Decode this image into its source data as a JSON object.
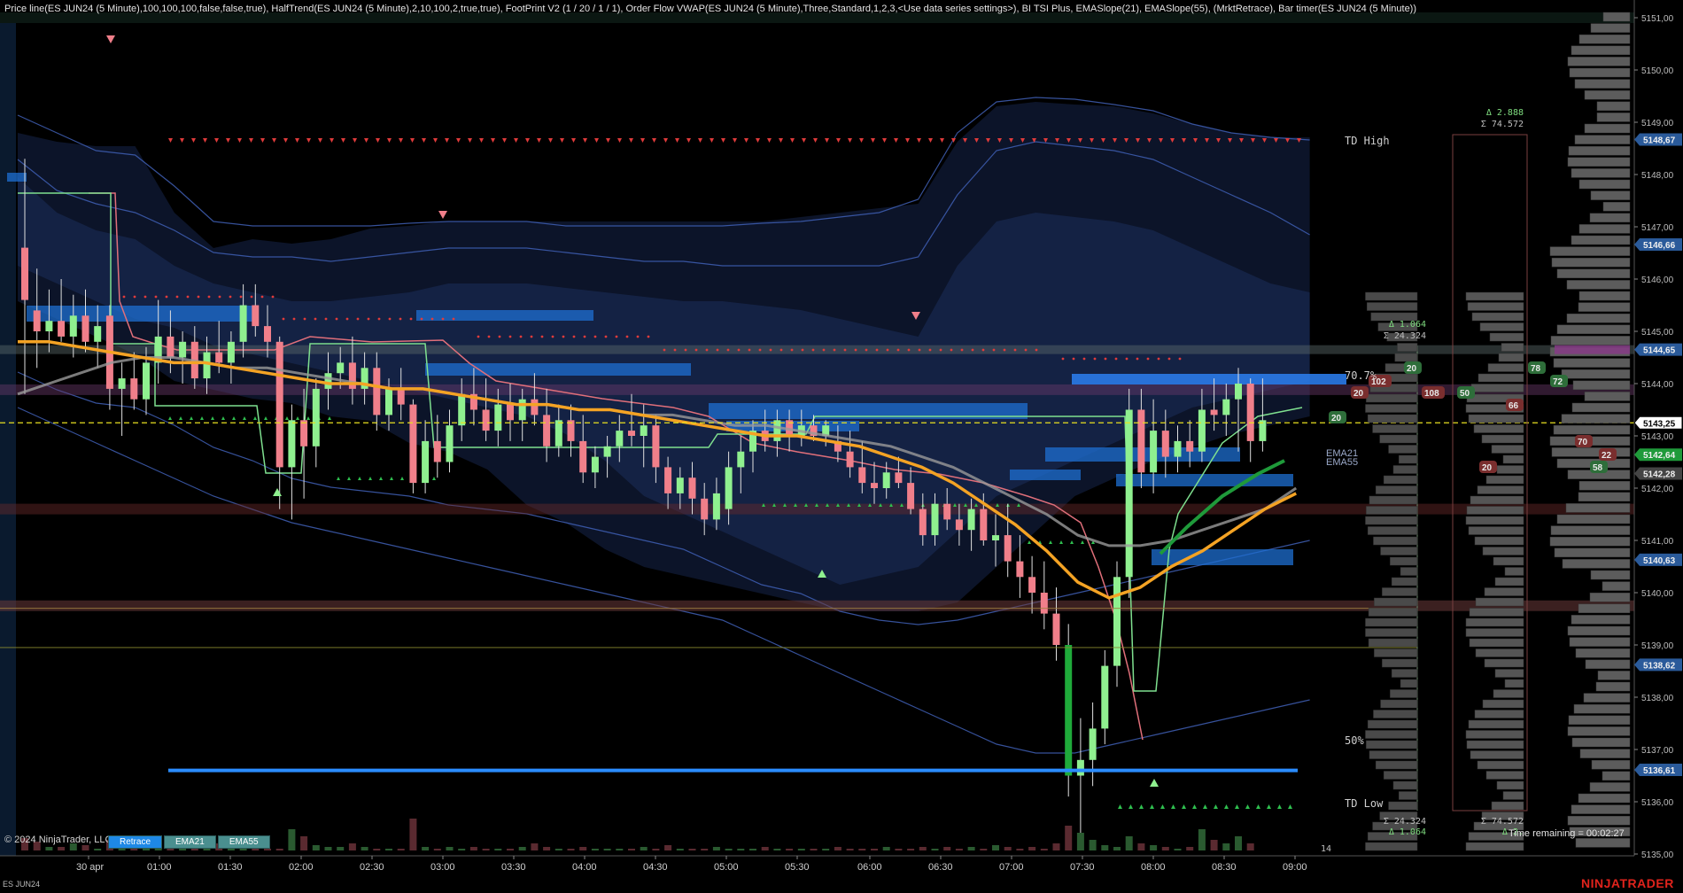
{
  "header": {
    "indicator_legend": "Price line(ES JUN24 (5 Minute),100,100,100,false,false,true), HalfTrend(ES JUN24 (5 Minute),2,10,100,2,true,true), FootPrint V2 (1 / 20 / 1 / 1), Order Flow VWAP(ES JUN24 (5 Minute),Three,Standard,1,2,3,<Use data series settings>), BI TSI Plus, EMASlope(21), EMASlope(55),  (MrktRetrace), Bar timer(ES JUN24 (5 Minute))"
  },
  "footer": {
    "copyright": "© 2024 NinjaTrader, LLC",
    "tabs": [
      "Retrace",
      "EMA21",
      "EMA55"
    ],
    "time_remaining": "Time remaining = 00:02:27",
    "instrument": "ES JUN24",
    "brand": "NINJATRADER"
  },
  "labels": {
    "td_high": "TD High",
    "td_low": "TD Low",
    "fib_70": "70.7%",
    "fib_50": "50%",
    "ema21": "EMA21",
    "ema55": "EMA55",
    "left_delta_top": "Δ 1.064",
    "left_sigma_top": "Σ 24.324",
    "left_sigma_bot": "Σ 24.324",
    "left_delta_bot": "Δ 1.064",
    "right_delta_top": "Δ 2.888",
    "right_sigma_top": "Σ 74.572",
    "right_sigma_bot": "Σ 74.572",
    "right_delta_bot": "Δ 2.",
    "bottom_number": "14"
  },
  "chart_data": {
    "type": "candlestick",
    "title": "",
    "instrument": "ES JUN24",
    "interval": "5 Minute",
    "date_label": "30 apr",
    "x_ticks": [
      "30 apr",
      "01:00",
      "01:30",
      "02:00",
      "02:30",
      "03:00",
      "03:30",
      "04:00",
      "04:30",
      "05:00",
      "05:30",
      "06:00",
      "06:30",
      "07:00",
      "07:30",
      "08:00",
      "08:30",
      "09:00"
    ],
    "y_ticks": [
      5151.0,
      5150.0,
      5149.0,
      5148.0,
      5147.0,
      5146.0,
      5145.0,
      5144.0,
      5143.0,
      5142.0,
      5141.0,
      5140.0,
      5139.0,
      5138.0,
      5137.0,
      5136.0,
      5135.0
    ],
    "ylim": [
      5134.6,
      5151.3
    ],
    "price_markers": [
      {
        "label": "5148.67",
        "value": 5148.67,
        "color": "#2a5a9a"
      },
      {
        "label": "5146.66",
        "value": 5146.66,
        "color": "#2a5a9a"
      },
      {
        "label": "5144.65",
        "value": 5144.65,
        "color": "#2a5a9a"
      },
      {
        "label": "5143.25",
        "value": 5143.25,
        "color": "#ffffff"
      },
      {
        "label": "5142.64",
        "value": 5142.64,
        "color": "#1f9a3a"
      },
      {
        "label": "5142.28",
        "value": 5142.28,
        "color": "#444444"
      },
      {
        "label": "5140.63",
        "value": 5140.63,
        "color": "#2a5a9a"
      },
      {
        "label": "5138.62",
        "value": 5138.62,
        "color": "#2a5a9a"
      },
      {
        "label": "5136.61",
        "value": 5136.61,
        "color": "#2a5a9a"
      }
    ],
    "footprint_boxes": [
      {
        "label": "20",
        "color": "#2e6e3a"
      },
      {
        "label": "78",
        "color": "#2e6e3a"
      },
      {
        "label": "72",
        "color": "#2e6e3a"
      },
      {
        "label": "102",
        "color": "#7a2e2e"
      },
      {
        "label": "20",
        "color": "#7a2e2e"
      },
      {
        "label": "108",
        "color": "#7a2e2e"
      },
      {
        "label": "50",
        "color": "#2e6e3a"
      },
      {
        "label": "66",
        "color": "#7a2e2e"
      },
      {
        "label": "20",
        "color": "#2e6e3a"
      },
      {
        "label": "70",
        "color": "#7a2e2e"
      },
      {
        "label": "22",
        "color": "#7a2e2e"
      },
      {
        "label": "20",
        "color": "#7a2e2e"
      },
      {
        "label": "58",
        "color": "#2e6e3a"
      }
    ],
    "candles": [
      {
        "o": 5146.6,
        "h": 5148.3,
        "l": 5143.8,
        "c": 5145.6
      },
      {
        "o": 5145.4,
        "h": 5146.2,
        "l": 5144.3,
        "c": 5145.0
      },
      {
        "o": 5145.0,
        "h": 5145.8,
        "l": 5144.6,
        "c": 5145.2
      },
      {
        "o": 5145.2,
        "h": 5146.0,
        "l": 5144.8,
        "c": 5144.9
      },
      {
        "o": 5144.9,
        "h": 5145.7,
        "l": 5144.5,
        "c": 5145.3
      },
      {
        "o": 5145.3,
        "h": 5145.8,
        "l": 5144.6,
        "c": 5144.8
      },
      {
        "o": 5144.8,
        "h": 5145.5,
        "l": 5144.3,
        "c": 5145.1
      },
      {
        "o": 5145.3,
        "h": 5145.5,
        "l": 5143.5,
        "c": 5143.9
      },
      {
        "o": 5143.9,
        "h": 5144.4,
        "l": 5143.0,
        "c": 5144.1
      },
      {
        "o": 5144.1,
        "h": 5144.6,
        "l": 5143.5,
        "c": 5143.7
      },
      {
        "o": 5143.7,
        "h": 5144.7,
        "l": 5143.4,
        "c": 5144.4
      },
      {
        "o": 5144.4,
        "h": 5145.6,
        "l": 5144.0,
        "c": 5144.9
      },
      {
        "o": 5144.9,
        "h": 5145.4,
        "l": 5144.2,
        "c": 5144.5
      },
      {
        "o": 5144.5,
        "h": 5145.0,
        "l": 5144.0,
        "c": 5144.8
      },
      {
        "o": 5144.8,
        "h": 5145.1,
        "l": 5143.9,
        "c": 5144.1
      },
      {
        "o": 5144.1,
        "h": 5144.9,
        "l": 5143.8,
        "c": 5144.6
      },
      {
        "o": 5144.6,
        "h": 5145.2,
        "l": 5144.2,
        "c": 5144.4
      },
      {
        "o": 5144.4,
        "h": 5145.0,
        "l": 5144.0,
        "c": 5144.8
      },
      {
        "o": 5144.8,
        "h": 5145.9,
        "l": 5144.5,
        "c": 5145.5
      },
      {
        "o": 5145.5,
        "h": 5145.9,
        "l": 5144.9,
        "c": 5145.1
      },
      {
        "o": 5145.1,
        "h": 5145.5,
        "l": 5144.5,
        "c": 5144.8
      },
      {
        "o": 5144.8,
        "h": 5144.9,
        "l": 5141.6,
        "c": 5142.4
      },
      {
        "o": 5142.4,
        "h": 5143.6,
        "l": 5141.4,
        "c": 5143.3
      },
      {
        "o": 5143.3,
        "h": 5143.9,
        "l": 5141.8,
        "c": 5142.8
      },
      {
        "o": 5142.8,
        "h": 5144.1,
        "l": 5142.4,
        "c": 5143.9
      },
      {
        "o": 5143.9,
        "h": 5144.6,
        "l": 5143.5,
        "c": 5144.2
      },
      {
        "o": 5144.2,
        "h": 5144.7,
        "l": 5143.9,
        "c": 5144.4
      },
      {
        "o": 5144.4,
        "h": 5144.9,
        "l": 5143.6,
        "c": 5143.9
      },
      {
        "o": 5143.9,
        "h": 5144.6,
        "l": 5143.6,
        "c": 5144.3
      },
      {
        "o": 5144.3,
        "h": 5144.6,
        "l": 5143.1,
        "c": 5143.4
      },
      {
        "o": 5143.4,
        "h": 5144.1,
        "l": 5143.1,
        "c": 5143.9
      },
      {
        "o": 5143.9,
        "h": 5144.3,
        "l": 5143.3,
        "c": 5143.6
      },
      {
        "o": 5143.6,
        "h": 5143.7,
        "l": 5141.9,
        "c": 5142.1
      },
      {
        "o": 5142.1,
        "h": 5143.3,
        "l": 5141.9,
        "c": 5142.9
      },
      {
        "o": 5142.9,
        "h": 5143.4,
        "l": 5142.2,
        "c": 5142.5
      },
      {
        "o": 5142.5,
        "h": 5143.5,
        "l": 5142.3,
        "c": 5143.2
      },
      {
        "o": 5143.2,
        "h": 5144.1,
        "l": 5142.9,
        "c": 5143.8
      },
      {
        "o": 5143.8,
        "h": 5144.3,
        "l": 5143.2,
        "c": 5143.5
      },
      {
        "o": 5143.5,
        "h": 5144.1,
        "l": 5142.9,
        "c": 5143.1
      },
      {
        "o": 5143.1,
        "h": 5143.9,
        "l": 5142.8,
        "c": 5143.6
      },
      {
        "o": 5143.6,
        "h": 5144.0,
        "l": 5142.9,
        "c": 5143.3
      },
      {
        "o": 5143.3,
        "h": 5143.9,
        "l": 5142.9,
        "c": 5143.7
      },
      {
        "o": 5143.7,
        "h": 5144.2,
        "l": 5143.2,
        "c": 5143.4
      },
      {
        "o": 5143.4,
        "h": 5143.9,
        "l": 5142.5,
        "c": 5142.8
      },
      {
        "o": 5142.8,
        "h": 5143.6,
        "l": 5142.6,
        "c": 5143.3
      },
      {
        "o": 5143.3,
        "h": 5143.6,
        "l": 5142.6,
        "c": 5142.9
      },
      {
        "o": 5142.9,
        "h": 5143.4,
        "l": 5142.1,
        "c": 5142.3
      },
      {
        "o": 5142.3,
        "h": 5142.8,
        "l": 5142.0,
        "c": 5142.6
      },
      {
        "o": 5142.6,
        "h": 5143.0,
        "l": 5142.2,
        "c": 5142.8
      },
      {
        "o": 5142.8,
        "h": 5143.4,
        "l": 5142.5,
        "c": 5143.1
      },
      {
        "o": 5143.1,
        "h": 5143.8,
        "l": 5142.8,
        "c": 5143.0
      },
      {
        "o": 5143.0,
        "h": 5143.6,
        "l": 5142.4,
        "c": 5143.2
      },
      {
        "o": 5143.2,
        "h": 5143.4,
        "l": 5142.1,
        "c": 5142.4
      },
      {
        "o": 5142.4,
        "h": 5142.6,
        "l": 5141.6,
        "c": 5141.9
      },
      {
        "o": 5141.9,
        "h": 5142.4,
        "l": 5141.6,
        "c": 5142.2
      },
      {
        "o": 5142.2,
        "h": 5142.5,
        "l": 5141.5,
        "c": 5141.8
      },
      {
        "o": 5141.8,
        "h": 5142.1,
        "l": 5141.1,
        "c": 5141.4
      },
      {
        "o": 5141.4,
        "h": 5142.2,
        "l": 5141.2,
        "c": 5141.9
      },
      {
        "o": 5141.6,
        "h": 5142.7,
        "l": 5141.3,
        "c": 5142.4
      },
      {
        "o": 5142.4,
        "h": 5143.0,
        "l": 5141.9,
        "c": 5142.7
      },
      {
        "o": 5142.7,
        "h": 5143.3,
        "l": 5142.3,
        "c": 5143.1
      },
      {
        "o": 5143.1,
        "h": 5143.5,
        "l": 5142.7,
        "c": 5142.9
      },
      {
        "o": 5142.9,
        "h": 5143.5,
        "l": 5142.6,
        "c": 5143.3
      },
      {
        "o": 5143.3,
        "h": 5143.5,
        "l": 5142.7,
        "c": 5143.0
      },
      {
        "o": 5143.0,
        "h": 5143.5,
        "l": 5142.8,
        "c": 5143.2
      },
      {
        "o": 5143.2,
        "h": 5143.4,
        "l": 5142.9,
        "c": 5143.0
      },
      {
        "o": 5143.0,
        "h": 5143.3,
        "l": 5142.8,
        "c": 5143.2
      },
      {
        "o": 5142.9,
        "h": 5143.2,
        "l": 5142.5,
        "c": 5142.7
      },
      {
        "o": 5142.7,
        "h": 5143.1,
        "l": 5142.2,
        "c": 5142.4
      },
      {
        "o": 5142.4,
        "h": 5142.9,
        "l": 5141.9,
        "c": 5142.1
      },
      {
        "o": 5142.1,
        "h": 5142.5,
        "l": 5141.7,
        "c": 5142.0
      },
      {
        "o": 5142.0,
        "h": 5142.5,
        "l": 5141.8,
        "c": 5142.3
      },
      {
        "o": 5142.3,
        "h": 5142.6,
        "l": 5142.0,
        "c": 5142.1
      },
      {
        "o": 5142.1,
        "h": 5142.4,
        "l": 5141.5,
        "c": 5141.6
      },
      {
        "o": 5141.6,
        "h": 5141.9,
        "l": 5140.9,
        "c": 5141.1
      },
      {
        "o": 5141.1,
        "h": 5141.9,
        "l": 5140.9,
        "c": 5141.7
      },
      {
        "o": 5141.7,
        "h": 5142.0,
        "l": 5141.2,
        "c": 5141.4
      },
      {
        "o": 5141.4,
        "h": 5141.7,
        "l": 5140.9,
        "c": 5141.2
      },
      {
        "o": 5141.2,
        "h": 5141.8,
        "l": 5140.8,
        "c": 5141.6
      },
      {
        "o": 5141.6,
        "h": 5141.9,
        "l": 5140.9,
        "c": 5141.0
      },
      {
        "o": 5141.0,
        "h": 5141.5,
        "l": 5140.5,
        "c": 5141.1
      },
      {
        "o": 5141.1,
        "h": 5141.7,
        "l": 5140.3,
        "c": 5140.6
      },
      {
        "o": 5140.6,
        "h": 5141.1,
        "l": 5139.9,
        "c": 5140.3
      },
      {
        "o": 5140.3,
        "h": 5140.7,
        "l": 5139.6,
        "c": 5140.0
      },
      {
        "o": 5140.0,
        "h": 5140.6,
        "l": 5139.3,
        "c": 5139.6
      },
      {
        "o": 5139.6,
        "h": 5140.1,
        "l": 5138.7,
        "c": 5139.0
      },
      {
        "o": 5139.0,
        "h": 5139.4,
        "l": 5136.1,
        "c": 5136.5
      },
      {
        "o": 5136.5,
        "h": 5137.6,
        "l": 5135.3,
        "c": 5136.8
      },
      {
        "o": 5136.8,
        "h": 5137.9,
        "l": 5136.3,
        "c": 5137.4
      },
      {
        "o": 5137.4,
        "h": 5138.9,
        "l": 5137.1,
        "c": 5138.6
      },
      {
        "o": 5138.6,
        "h": 5140.6,
        "l": 5138.2,
        "c": 5140.3
      },
      {
        "o": 5140.3,
        "h": 5143.9,
        "l": 5139.9,
        "c": 5143.5
      },
      {
        "o": 5143.5,
        "h": 5143.9,
        "l": 5142.0,
        "c": 5142.3
      },
      {
        "o": 5142.3,
        "h": 5143.7,
        "l": 5141.9,
        "c": 5143.1
      },
      {
        "o": 5143.1,
        "h": 5143.5,
        "l": 5142.2,
        "c": 5142.6
      },
      {
        "o": 5142.6,
        "h": 5143.2,
        "l": 5142.3,
        "c": 5142.9
      },
      {
        "o": 5142.9,
        "h": 5143.3,
        "l": 5142.4,
        "c": 5142.7
      },
      {
        "o": 5142.7,
        "h": 5143.9,
        "l": 5142.5,
        "c": 5143.5
      },
      {
        "o": 5143.5,
        "h": 5144.1,
        "l": 5143.1,
        "c": 5143.4
      },
      {
        "o": 5143.4,
        "h": 5144.0,
        "l": 5143.0,
        "c": 5143.7
      },
      {
        "o": 5143.7,
        "h": 5144.3,
        "l": 5142.7,
        "c": 5144.0
      },
      {
        "o": 5144.0,
        "h": 5144.1,
        "l": 5142.5,
        "c": 5142.9
      },
      {
        "o": 5142.9,
        "h": 5144.1,
        "l": 5142.7,
        "c": 5143.3
      }
    ],
    "ema21_path": [
      5144.8,
      5144.8,
      5144.7,
      5144.6,
      5144.5,
      5144.4,
      5144.4,
      5144.3,
      5144.2,
      5144.1,
      5144.0,
      5144.0,
      5143.9,
      5143.9,
      5143.8,
      5143.7,
      5143.6,
      5143.6,
      5143.5,
      5143.5,
      5143.4,
      5143.3,
      5143.2,
      5143.1,
      5143.0,
      5143.0,
      5142.9,
      5142.8,
      5142.6,
      5142.4,
      5142.1,
      5141.7,
      5141.3,
      5140.8,
      5140.2,
      5139.9,
      5140.1,
      5140.5,
      5140.8,
      5141.2,
      5141.6,
      5141.9
    ],
    "ema55_path": [
      5143.8,
      5144.0,
      5144.2,
      5144.4,
      5144.5,
      5144.5,
      5144.4,
      5144.3,
      5144.3,
      5144.2,
      5144.1,
      5144.0,
      5143.9,
      5143.9,
      5143.8,
      5143.7,
      5143.6,
      5143.6,
      5143.5,
      5143.5,
      5143.4,
      5143.4,
      5143.3,
      5143.2,
      5143.2,
      5143.1,
      5143.0,
      5142.9,
      5142.8,
      5142.6,
      5142.4,
      5142.1,
      5141.8,
      5141.5,
      5141.1,
      5140.9,
      5140.9,
      5141.0,
      5141.2,
      5141.4,
      5141.6,
      5142.0
    ],
    "fib_levels": [
      {
        "label": "TD High",
        "value": 5148.5
      },
      {
        "label": "70.7%",
        "value": 5143.8
      },
      {
        "label": "50%",
        "value": 5136.6
      },
      {
        "label": "TD Low",
        "value": 5135.3
      }
    ],
    "volume": [
      0.35,
      0.25,
      0.1,
      0.1,
      0.2,
      0.15,
      0.05,
      0.3,
      0.1,
      0.05,
      0.05,
      0.2,
      0.1,
      0.15,
      0.05,
      0.05,
      0.2,
      0.15,
      0.05,
      0.1,
      0.05,
      0.05,
      0.6,
      0.4,
      0.15,
      0.1,
      0.1,
      0.2,
      0.1,
      0.05,
      0.05,
      0.05,
      0.9,
      0.1,
      0.05,
      0.1,
      0.05,
      0.1,
      0.05,
      0.05,
      0.05,
      0.1,
      0.2,
      0.1,
      0.05,
      0.05,
      0.1,
      0.05,
      0.05,
      0.05,
      0.05,
      0.1,
      0.05,
      0.15,
      0.05,
      0.05,
      0.05,
      0.1,
      0.05,
      0.05,
      0.05,
      0.1,
      0.05,
      0.05,
      0.05,
      0.05,
      0.05,
      0.1,
      0.05,
      0.05,
      0.05,
      0.1,
      0.05,
      0.05,
      0.1,
      0.05,
      0.1,
      0.05,
      0.1,
      0.05,
      0.15,
      0.1,
      0.05,
      0.1,
      0.05,
      0.2,
      0.7,
      0.5,
      0.3,
      0.15,
      0.1,
      0.4,
      0.2,
      0.15,
      0.1,
      0.05,
      0.1,
      0.6,
      0.3,
      0.2,
      0.4,
      0.2
    ]
  }
}
